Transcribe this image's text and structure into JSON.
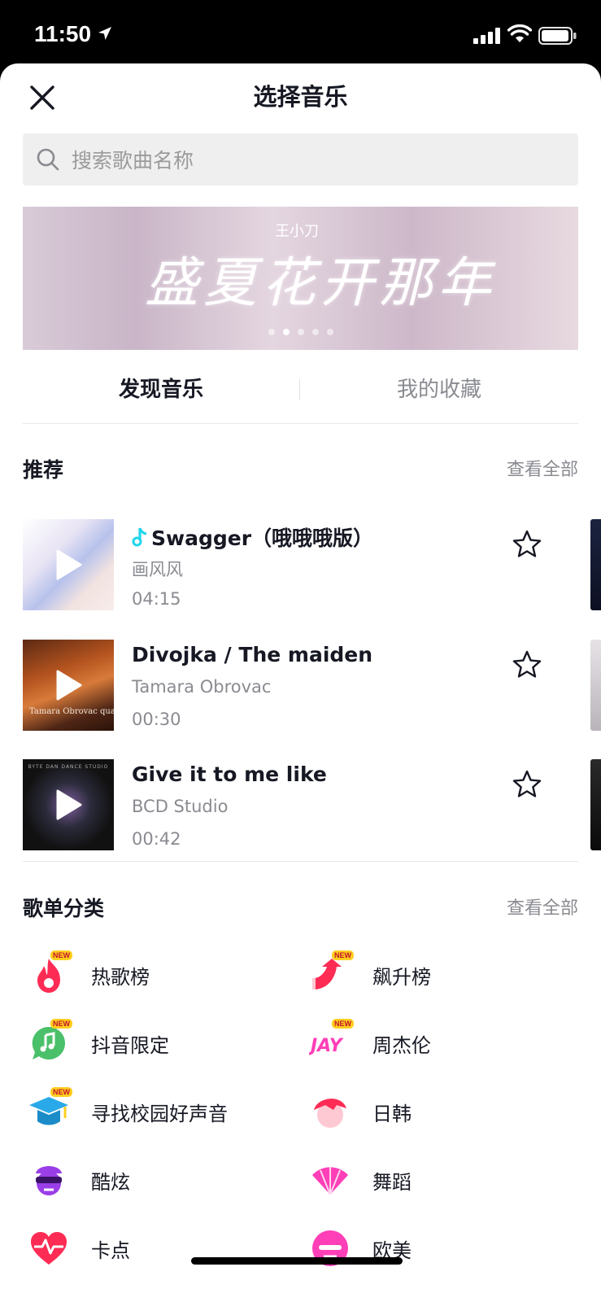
{
  "status_bar": {
    "time": "11:50"
  },
  "header": {
    "title": "选择音乐"
  },
  "search": {
    "placeholder": "搜索歌曲名称"
  },
  "banner": {
    "title": "盛夏花开那年",
    "artist": "王小刀"
  },
  "tabs": [
    {
      "label": "发现音乐",
      "active": true
    },
    {
      "label": "我的收藏",
      "active": false
    }
  ],
  "recommended": {
    "title": "推荐",
    "view_all": "查看全部",
    "songs": [
      {
        "title": "Swagger（哦哦哦版）",
        "artist": "画风风",
        "duration": "04:15",
        "original": true
      },
      {
        "title": "Divojka / The maiden",
        "artist": "Tamara Obrovac",
        "duration": "00:30",
        "cover_text": "Tamara Obrovac quartet"
      },
      {
        "title": "Give it to me like",
        "artist": "BCD Studio",
        "duration": "00:42",
        "cover_text": "BYTE DAN DANCE STUDIO"
      }
    ]
  },
  "playlists": {
    "title": "歌单分类",
    "view_all": "查看全部",
    "new_badge": "NEW",
    "items": [
      {
        "label": "热歌榜",
        "icon": "fire-icon",
        "color": "#fe2c55",
        "is_new": true
      },
      {
        "label": "飙升榜",
        "icon": "rising-arrow-icon",
        "color": "#fe2c55",
        "is_new": true
      },
      {
        "label": "抖音限定",
        "icon": "music-bubble-icon",
        "color": "#4bc06a",
        "is_new": true
      },
      {
        "label": "周杰伦",
        "icon": "jay-logo-icon",
        "color": "#ff3fb8",
        "is_new": true
      },
      {
        "label": "寻找校园好声音",
        "icon": "graduation-cap-icon",
        "color": "#2aa9e8",
        "is_new": true
      },
      {
        "label": "日韩",
        "icon": "anime-face-icon",
        "color": "#fe2c55",
        "is_new": false
      },
      {
        "label": "酷炫",
        "icon": "cool-face-icon",
        "color": "#9a3ee8",
        "is_new": false
      },
      {
        "label": "舞蹈",
        "icon": "fan-icon",
        "color": "#ff3fb8",
        "is_new": false
      },
      {
        "label": "卡点",
        "icon": "heartbeat-icon",
        "color": "#fe2c55",
        "is_new": false
      },
      {
        "label": "欧美",
        "icon": "western-face-icon",
        "color": "#ff3fb8",
        "is_new": false
      }
    ]
  }
}
